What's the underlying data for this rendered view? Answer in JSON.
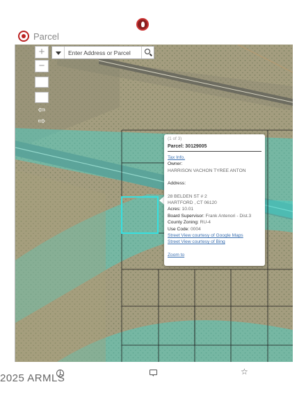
{
  "header": {
    "title": "Parcel",
    "logo_icon": "brand-logo-icon",
    "app_icon": "parcel-app-icon"
  },
  "map": {
    "search": {
      "placeholder": "Enter Address or Parcel"
    },
    "controls": [
      "zoom-in-icon",
      "zoom-out-icon",
      "blank",
      "blank",
      "back-arrow-icon",
      "forward-arrow-icon"
    ],
    "zoom_in_label": "+",
    "zoom_out_label": "−",
    "prev_label": "⇦",
    "next_label": "⇨",
    "colors": {
      "highlight": "#35e0e0",
      "wash": "#3fd6d0"
    }
  },
  "popup": {
    "count": "(1 of 3)",
    "title": "Parcel: 30129005",
    "tax_info": "Tax Info.",
    "owner_label": "Owner:",
    "owner_value": "HARRISON VACHON TYREE ANTON",
    "address_label": "Address:",
    "address_line1": "28 BELDEN ST # 2",
    "address_line2": "HARTFORD , CT  06120",
    "acres_label": "Acres:",
    "acres_value": "10.01",
    "supervisor_label": "Board Supervisor:",
    "supervisor_value": "Frank Antenori - Dist.3",
    "zoning_label": "County Zoning:",
    "zoning_value": "RU-4",
    "usecode_label": "Use Code:",
    "usecode_value": "0004",
    "street_google": "Street View courtesy of Google Maps",
    "street_bing": "Street View courtesy of Bing",
    "zoom_to": "Zoom to"
  },
  "footer": {
    "copyright": "2025 ARMLS",
    "icons": [
      "info-icon",
      "chat-icon",
      "star-icon"
    ],
    "info_glyph": "i",
    "star_glyph": "☆"
  }
}
